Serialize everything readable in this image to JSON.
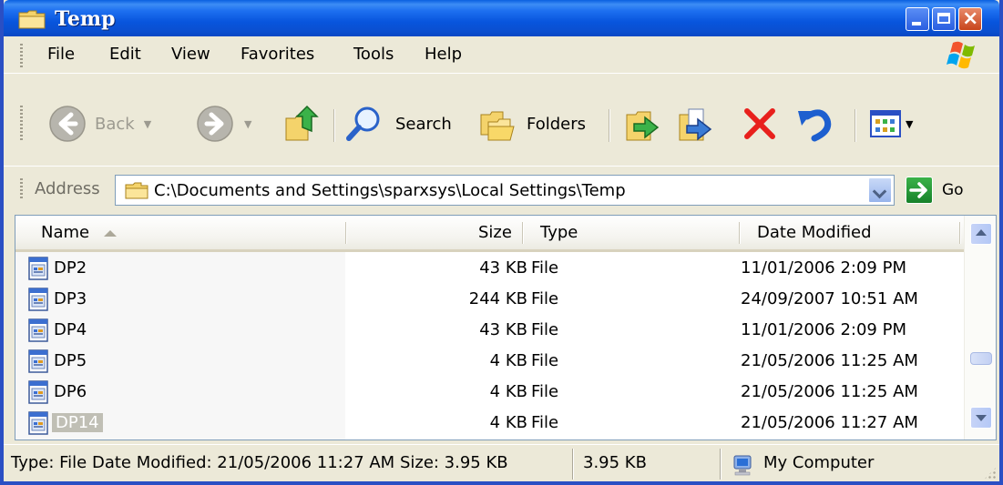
{
  "window": {
    "title": "Temp",
    "caption_close_glyph": "×"
  },
  "menu": [
    "File",
    "Edit",
    "View",
    "Favorites",
    "Tools",
    "Help"
  ],
  "toolbar": {
    "back_label": "Back",
    "search_label": "Search",
    "folders_label": "Folders",
    "drop_glyph": "▼"
  },
  "address": {
    "label": "Address",
    "value": "C:\\Documents and Settings\\sparxsys\\Local Settings\\Temp",
    "go_label": "Go"
  },
  "columns": {
    "name": "Name",
    "size": "Size",
    "type": "Type",
    "date": "Date Modified"
  },
  "files": [
    {
      "name": "DP2",
      "size": "43 KB",
      "type": "File",
      "date": "11/01/2006 2:09 PM"
    },
    {
      "name": "DP3",
      "size": "244 KB",
      "type": "File",
      "date": "24/09/2007 10:51 AM"
    },
    {
      "name": "DP4",
      "size": "43 KB",
      "type": "File",
      "date": "11/01/2006 2:09 PM"
    },
    {
      "name": "DP5",
      "size": "4 KB",
      "type": "File",
      "date": "21/05/2006 11:25 AM"
    },
    {
      "name": "DP6",
      "size": "4 KB",
      "type": "File",
      "date": "21/05/2006 11:25 AM"
    },
    {
      "name": "DP14",
      "size": "4 KB",
      "type": "File",
      "date": "21/05/2006 11:27 AM",
      "selected": true
    }
  ],
  "status": {
    "details": "Type: File Date Modified: 21/05/2006 11:27 AM Size: 3.95 KB",
    "size": "3.95 KB",
    "zone": "My Computer"
  },
  "icons": {
    "window": "folder-icon",
    "back": "back-arrow-icon",
    "forward": "forward-arrow-icon",
    "up": "up-folder-icon",
    "search": "magnifier-icon",
    "folders": "folders-icon",
    "move_to": "move-to-icon",
    "copy_to": "copy-to-icon",
    "delete": "delete-x-icon",
    "undo": "undo-icon",
    "views": "views-icon",
    "file": "file-icon",
    "computer": "my-computer-icon"
  },
  "colors": {
    "titlebar": "#0a5fe0",
    "chrome": "#ece9d8",
    "delete_red": "#e8201c",
    "selection": "#c0bfb5"
  }
}
